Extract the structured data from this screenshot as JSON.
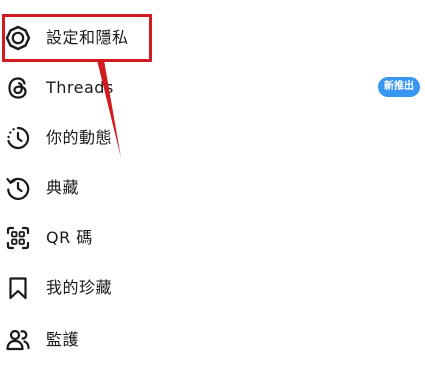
{
  "menu": {
    "items": [
      {
        "id": "settings",
        "label": "設定和隱私",
        "icon": "settings-gear-icon"
      },
      {
        "id": "threads",
        "label": "Threads",
        "icon": "threads-logo-icon",
        "badge": "新推出"
      },
      {
        "id": "activity",
        "label": "你的動態",
        "icon": "activity-clock-icon"
      },
      {
        "id": "archive",
        "label": "典藏",
        "icon": "archive-history-icon"
      },
      {
        "id": "qr",
        "label": "QR 碼",
        "icon": "qr-code-icon"
      },
      {
        "id": "saved",
        "label": "我的珍藏",
        "icon": "bookmark-icon"
      },
      {
        "id": "supervision",
        "label": "監護",
        "icon": "supervision-people-icon"
      }
    ]
  },
  "colors": {
    "highlight": "#d01b22",
    "badge": "#3897f0",
    "text": "#1a1a1a"
  }
}
